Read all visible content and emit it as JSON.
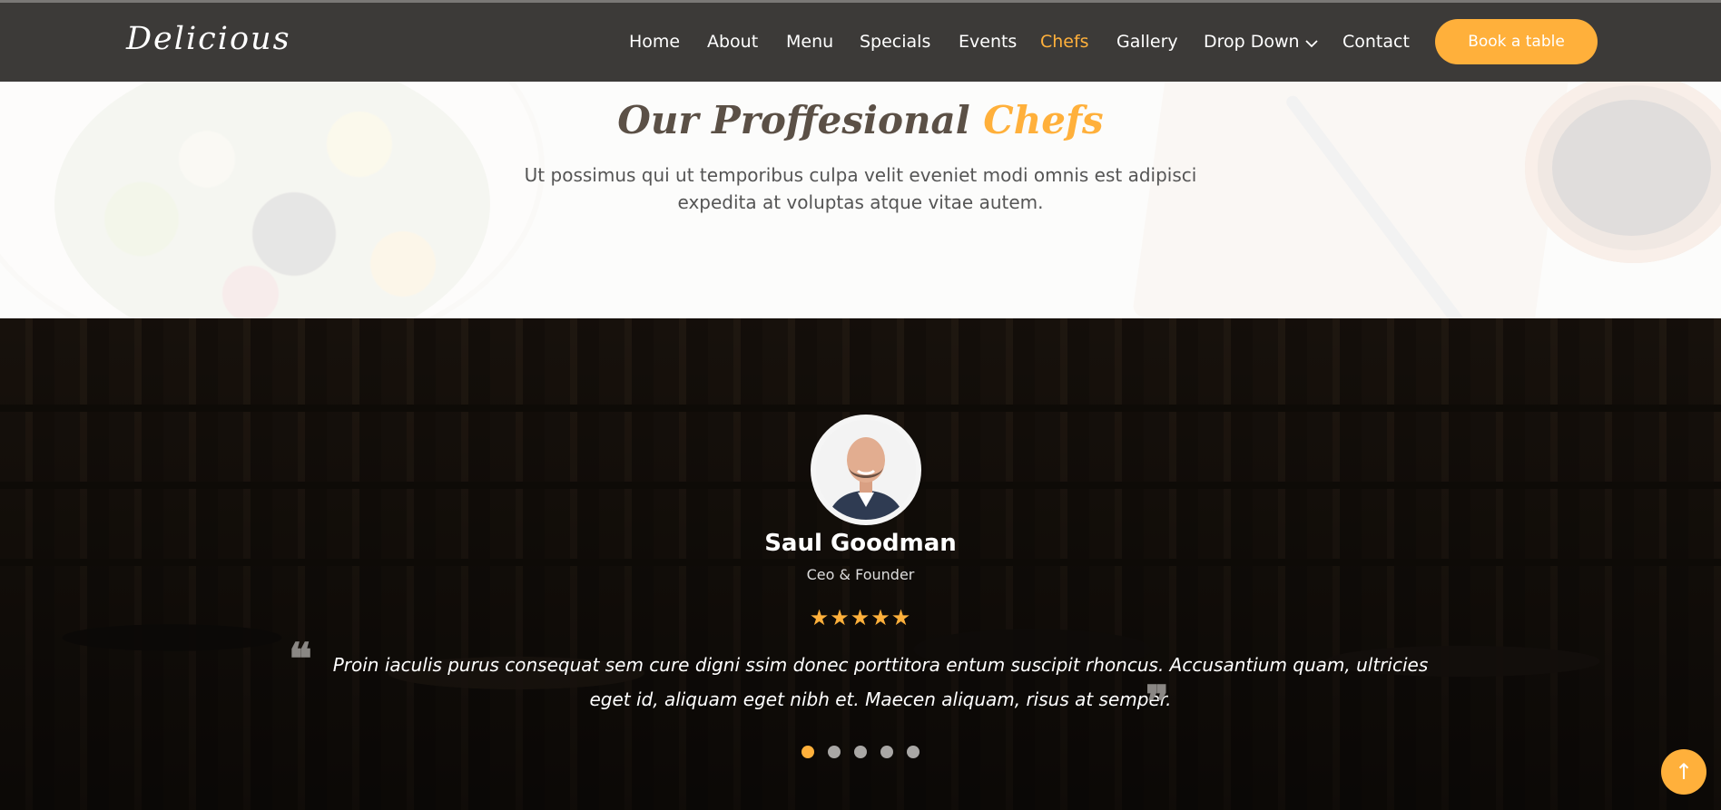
{
  "header": {
    "logo": "Delicious",
    "nav": [
      {
        "label": "Home",
        "active": false
      },
      {
        "label": "About",
        "active": false
      },
      {
        "label": "Menu",
        "active": false
      },
      {
        "label": "Specials",
        "active": false
      },
      {
        "label": "Events",
        "active": false
      },
      {
        "label": "Chefs",
        "active": true
      },
      {
        "label": "Gallery",
        "active": false
      },
      {
        "label": "Drop Down",
        "active": false,
        "dropdown": true
      },
      {
        "label": "Contact",
        "active": false
      }
    ],
    "book_button": "Book a table"
  },
  "chefs": {
    "title_main": "Our Proffesional",
    "title_accent": "Chefs",
    "description": "Ut possimus qui ut temporibus culpa velit eveniet modi omnis est adipisci expedita at voluptas atque vitae autem."
  },
  "testimonial": {
    "name": "Saul Goodman",
    "role": "Ceo & Founder",
    "rating": 5,
    "stars": "★★★★★",
    "quote_open": "❝",
    "quote_close": "❞",
    "text": "Proin iaculis purus consequat sem cure digni ssim donec porttitora entum suscipit rhoncus. Accusantium quam, ultricies eget id, aliquam eget nibh et. Maecen aliquam, risus at semper.",
    "pagination": {
      "count": 5,
      "active_index": 0
    }
  },
  "back_to_top": {
    "icon": "arrow-up-icon",
    "glyph": "↑"
  },
  "colors": {
    "accent": "#ffb03b",
    "header_bg": "#3c3a38"
  }
}
